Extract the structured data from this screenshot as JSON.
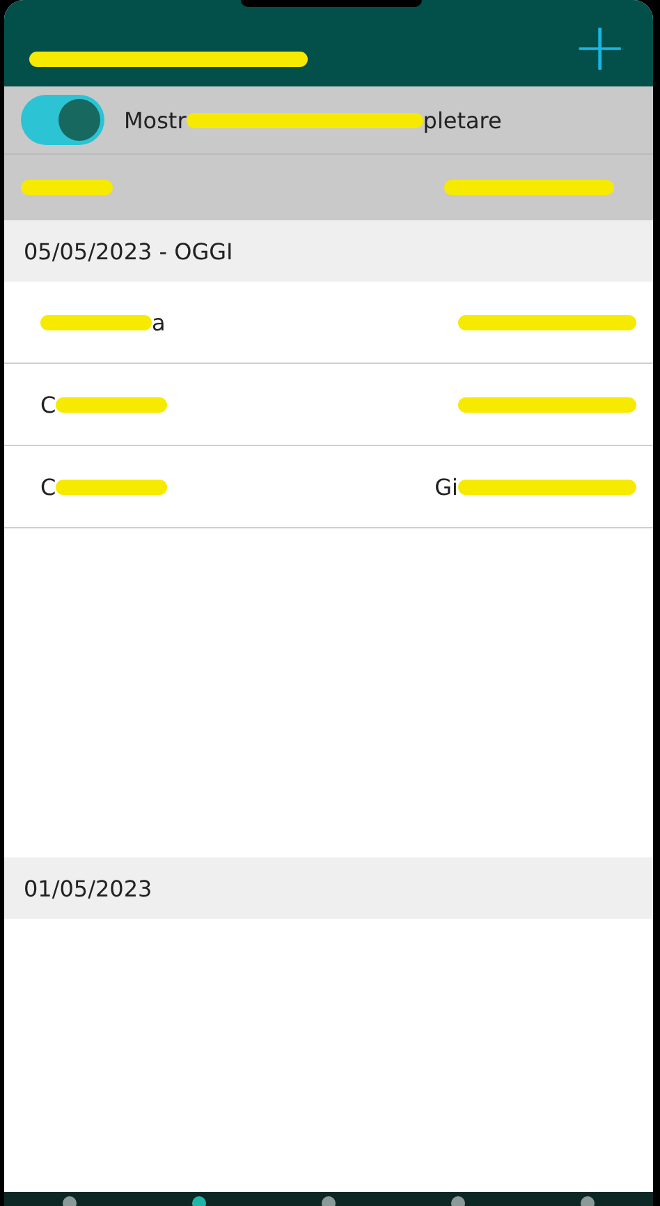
{
  "header": {
    "title": {
      "redacted": true
    },
    "add_button": "+"
  },
  "filter": {
    "on": true,
    "label": {
      "before": "Mostr",
      "redacted": true,
      "after": "pletare"
    }
  },
  "columns": [
    {
      "redacted": true
    },
    {
      "redacted": true
    }
  ],
  "sections": [
    {
      "date": "05/05/2023 - OGGI",
      "rows": [
        {
          "site": {
            "redacted": true,
            "after": "a"
          },
          "manager": {
            "redacted": true
          }
        },
        {
          "site": {
            "before": "C",
            "redacted": true
          },
          "manager": {
            "redacted": true
          }
        },
        {
          "site": {
            "before": "C",
            "redacted": true
          },
          "manager": {
            "before": "Gi",
            "redacted": true
          }
        }
      ]
    },
    {
      "date": "01/05/2023"
    }
  ]
}
